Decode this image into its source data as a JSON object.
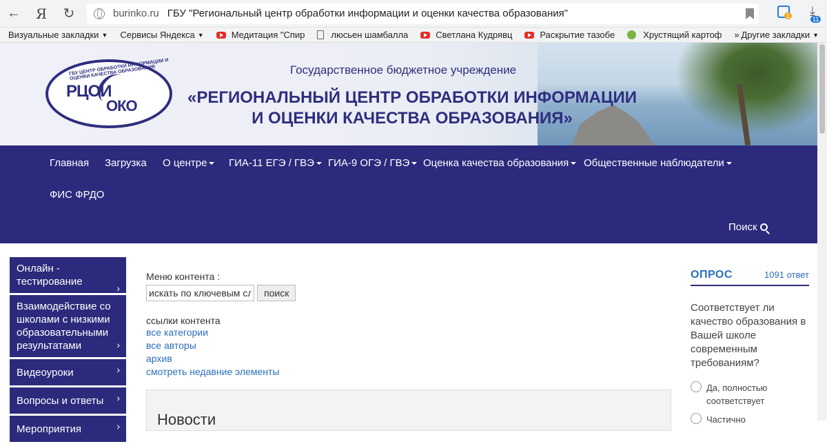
{
  "browser": {
    "back_icon": "←",
    "yandex_icon": "Я",
    "reload_icon": "↻",
    "domain": "burinko.ru",
    "page_title": "ГБУ \"Региональный центр обработки информации и оценки качества образования\"",
    "ext_badge": "1",
    "downloads_badge": "11"
  },
  "bookmarks": {
    "items": [
      {
        "label": "Визуальные закладки",
        "icon": ""
      },
      {
        "label": "Сервисы Яндекса",
        "icon": ""
      },
      {
        "label": "Медитация \"Спир",
        "icon": "youtube-icon"
      },
      {
        "label": "люсьен шамбалла",
        "icon": "document-icon"
      },
      {
        "label": "Светлана Кудрявц",
        "icon": "youtube-icon"
      },
      {
        "label": "Раскрытие тазобе",
        "icon": "youtube-icon"
      },
      {
        "label": "Хрустящий картоф",
        "icon": "leaf-icon"
      }
    ],
    "more": "»",
    "other": "Другие закладки"
  },
  "header": {
    "logo_main": "РЦОИ",
    "logo_sub": "ОКО",
    "logo_arc": "ГБУ ЦЕНТР ОБРАБОТКИ ИНФОРМАЦИИ И ОЦЕНКИ КАЧЕСТВА ОБРАЗОВАНИЯ",
    "subtitle": "Государственное бюджетное учреждение",
    "title": "«РЕГИОНАЛЬНЫЙ ЦЕНТР ОБРАБОТКИ ИНФОРМАЦИИ И ОЦЕНКИ КАЧЕСТВА ОБРАЗОВАНИЯ»"
  },
  "nav": {
    "items": [
      "Главная",
      "Загрузка",
      "О центре",
      "ГИА-11 ЕГЭ / ГВЭ",
      "ГИА-9 ОГЭ / ГВЭ",
      "Оценка качества образования",
      "Общественные наблюдатели",
      "ФИС ФРДО"
    ],
    "search": "Поиск"
  },
  "sidebar": {
    "items": [
      "Онлайн - тестирование",
      "Взаимодействие со школами с низкими образовательными результатами",
      "Видеоуроки",
      "Вопросы и ответы",
      "Мероприятия"
    ]
  },
  "content": {
    "menu_label": "Меню контента :",
    "search_placeholder": "искать по ключевым сло",
    "search_button": "поиск",
    "links_label": "ссылки контента",
    "links": [
      "все категории",
      "все авторы",
      "архив",
      "смотреть недавние элементы"
    ],
    "news_title": "Новости"
  },
  "poll": {
    "title": "ОПРОС",
    "count": "1091 ответ",
    "question": "Соответствует ли качество образования в Вашей школе современным требованиям?",
    "options": [
      "Да, полностью соответствует",
      "Частично"
    ]
  }
}
